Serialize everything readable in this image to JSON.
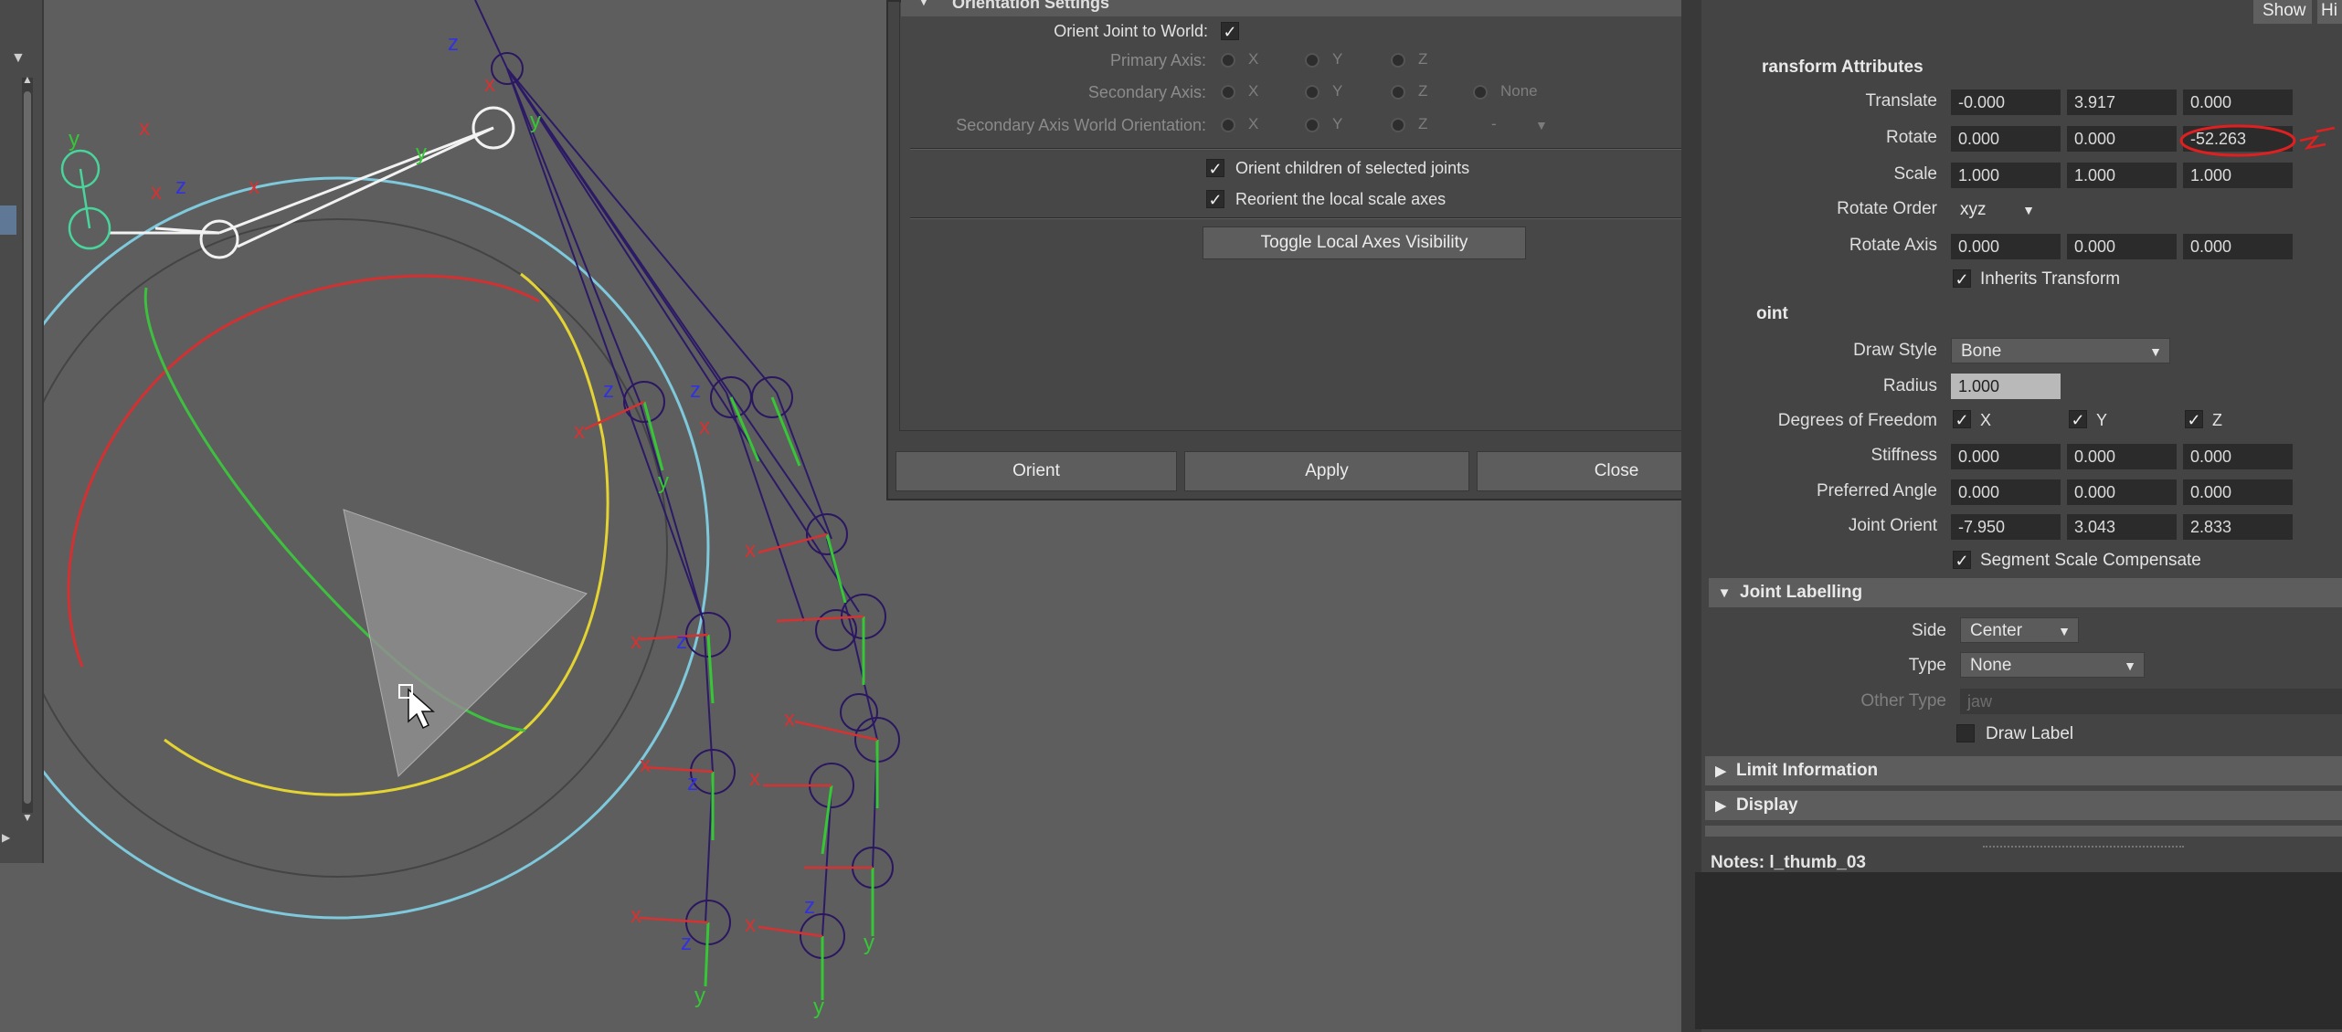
{
  "viewport": {
    "axis_labels": {
      "x": "x",
      "y": "y",
      "z": "z"
    }
  },
  "orient_dialog": {
    "section_title": "Orientation Settings",
    "orient_to_world_label": "Orient Joint to World:",
    "orient_to_world_checked": true,
    "primary_axis_label": "Primary Axis:",
    "secondary_axis_label": "Secondary Axis:",
    "secondary_world_label": "Secondary Axis World Orientation:",
    "radio_x": "X",
    "radio_y": "Y",
    "radio_z": "Z",
    "radio_none": "None",
    "dash": "-",
    "orient_children_label": "Orient children of selected joints",
    "reorient_scale_label": "Reorient the local scale axes",
    "toggle_axes_label": "Toggle Local Axes Visibility",
    "orient_button": "Orient",
    "apply_button": "Apply",
    "close_button": "Close"
  },
  "attr_editor": {
    "show_button": "Show",
    "hide_button": "Hi",
    "transform_section": "ransform Attributes",
    "translate_label": "Translate",
    "translate": [
      "-0.000",
      "3.917",
      "0.000"
    ],
    "rotate_label": "Rotate",
    "rotate": [
      "0.000",
      "0.000",
      "-52.263"
    ],
    "scale_label": "Scale",
    "scale": [
      "1.000",
      "1.000",
      "1.000"
    ],
    "rotate_order_label": "Rotate Order",
    "rotate_order": "xyz",
    "rotate_axis_label": "Rotate Axis",
    "rotate_axis": [
      "0.000",
      "0.000",
      "0.000"
    ],
    "inherits_transform_label": "Inherits Transform",
    "joint_section": "oint",
    "draw_style_label": "Draw Style",
    "draw_style": "Bone",
    "radius_label": "Radius",
    "radius": "1.000",
    "dof_label": "Degrees of Freedom",
    "dof": [
      "X",
      "Y",
      "Z"
    ],
    "stiffness_label": "Stiffness",
    "stiffness": [
      "0.000",
      "0.000",
      "0.000"
    ],
    "preferred_angle_label": "Preferred Angle",
    "preferred_angle": [
      "0.000",
      "0.000",
      "0.000"
    ],
    "joint_orient_label": "Joint Orient",
    "joint_orient": [
      "-7.950",
      "3.043",
      "2.833"
    ],
    "segment_scale_label": "Segment Scale Compensate",
    "joint_labelling_section": "Joint Labelling",
    "side_label": "Side",
    "side": "Center",
    "type_label": "Type",
    "type": "None",
    "other_type_label": "Other Type",
    "other_type": "jaw",
    "draw_label_label": "Draw Label",
    "limit_information_section": "Limit Information",
    "display_section": "Display",
    "notes_label": "Notes:  l_thumb_03"
  }
}
